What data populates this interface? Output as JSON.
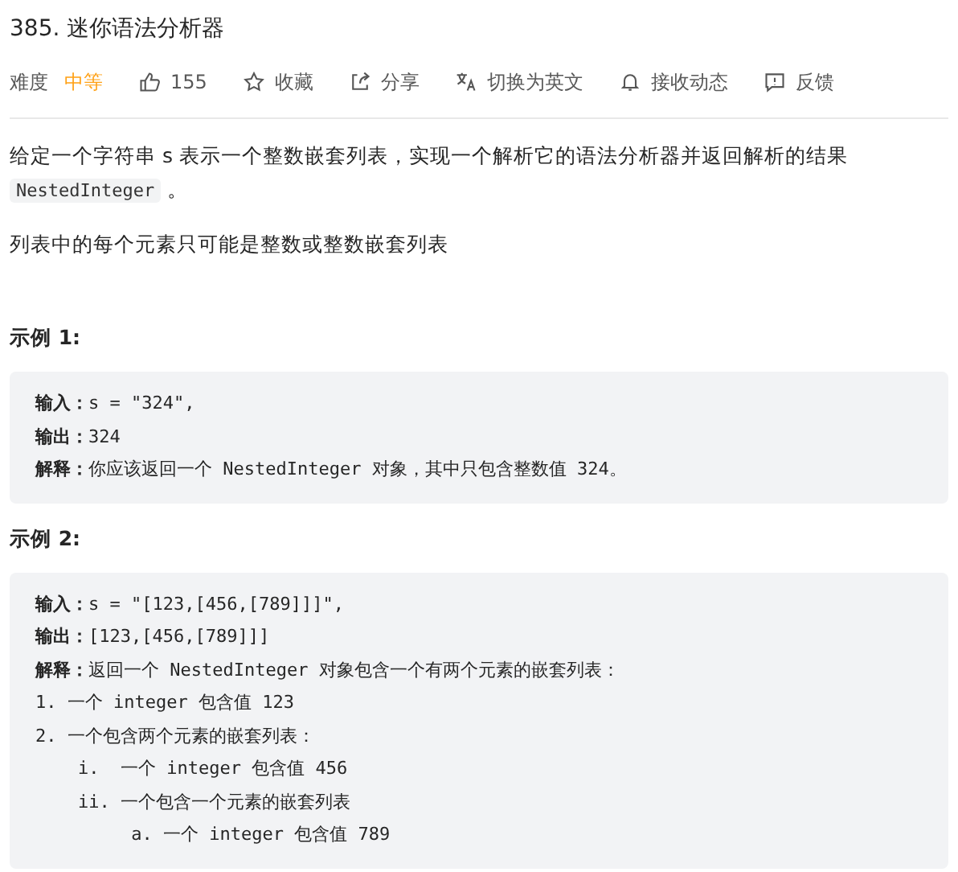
{
  "title": "385. 迷你语法分析器",
  "toolbar": [
    {
      "kind": "difficulty",
      "label": "难度",
      "value": "中等"
    },
    {
      "kind": "like",
      "label": "155"
    },
    {
      "kind": "star",
      "label": "收藏"
    },
    {
      "kind": "share",
      "label": "分享"
    },
    {
      "kind": "translate",
      "label": "切换为英文"
    },
    {
      "kind": "bell",
      "label": "接收动态"
    },
    {
      "kind": "feedback",
      "label": "反馈"
    }
  ],
  "description": [
    [
      {
        "kind": "text",
        "text": "给定一个字符串 s 表示一个整数嵌套列表，实现一个解析它的语法分析器并返回解析的结果 "
      },
      {
        "kind": "code",
        "text": "NestedInteger"
      },
      {
        "kind": "text",
        "text": " 。"
      }
    ],
    [
      {
        "kind": "text",
        "text": "列表中的每个元素只可能是整数或整数嵌套列表"
      }
    ]
  ],
  "examples": [
    {
      "heading": "示例 1:",
      "lines": [
        "**输入：**s = \"324\",",
        "**输出：**324",
        "**解释：**你应该返回一个 NestedInteger 对象，其中只包含整数值 324。"
      ]
    },
    {
      "heading": "示例 2:",
      "lines": [
        "**输入：**s = \"[123,[456,[789]]]\",",
        "**输出：**[123,[456,[789]]]",
        "**解释：**返回一个 NestedInteger 对象包含一个有两个元素的嵌套列表：",
        "1. 一个 integer 包含值 123",
        "2. 一个包含两个元素的嵌套列表：",
        "    i.  一个 integer 包含值 456",
        "    ii. 一个包含一个元素的嵌套列表",
        "         a. 一个 integer 包含值 789"
      ]
    }
  ]
}
